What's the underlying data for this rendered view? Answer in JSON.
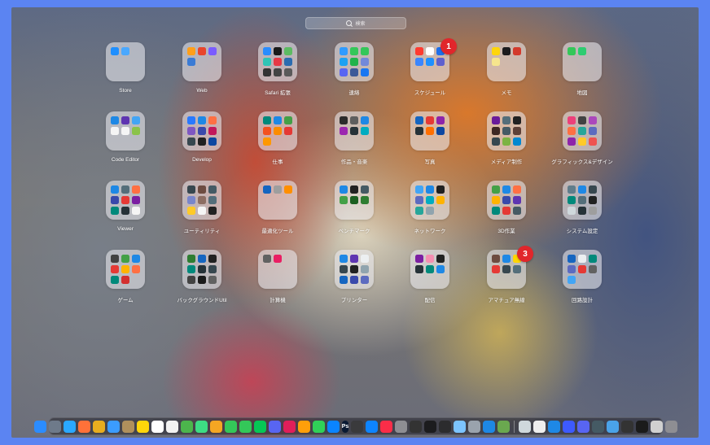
{
  "search": {
    "placeholder": "検索"
  },
  "folders": [
    {
      "label": "Store",
      "apps": [
        "#1f8fff",
        "#4aa8ff"
      ]
    },
    {
      "label": "Web",
      "apps": [
        "#ff9f1a",
        "#e8452c",
        "#7a5cff",
        "#3a7bd5"
      ]
    },
    {
      "label": "Safari 拡張",
      "apps": [
        "#2a8cff",
        "#1a1a1a",
        "#5dbb63",
        "#2ec4b6",
        "#e63946",
        "#2b6cb0",
        "#333333",
        "#444444",
        "#5a5a5a"
      ]
    },
    {
      "label": "連絡",
      "apps": [
        "#2f9bff",
        "#34c759",
        "#34c759",
        "#1da1f2",
        "#20b34a",
        "#7289da",
        "#5865f2",
        "#3b5998",
        "#1877f2"
      ]
    },
    {
      "label": "スケジュール",
      "apps": [
        "#ff3b30",
        "#ffffff",
        "#1f6feb",
        "#3a86ff",
        "#1e90ff",
        "#5e60ce"
      ],
      "badge": "1"
    },
    {
      "label": "メモ",
      "apps": [
        "#ffd60a",
        "#1c1c1e",
        "#d33a2c",
        "#f6e58d"
      ]
    },
    {
      "label": "地図",
      "apps": [
        "#34c759",
        "#2ecc71"
      ]
    },
    {
      "label": "Code Editor",
      "apps": [
        "#1e88e5",
        "#5e35b1",
        "#42a5f5",
        "#f5f5f5",
        "#f5f5f5",
        "#8bc34a"
      ]
    },
    {
      "label": "Develop",
      "apps": [
        "#2979ff",
        "#1e88e5",
        "#ff7043",
        "#7e57c2",
        "#3949ab",
        "#c2185b",
        "#37474f",
        "#212121",
        "#0d47a1"
      ]
    },
    {
      "label": "仕事",
      "apps": [
        "#00897b",
        "#1e88e5",
        "#43a047",
        "#f4511e",
        "#fb8c00",
        "#e53935",
        "#ff9800"
      ]
    },
    {
      "label": "作品・音楽",
      "apps": [
        "#2b2b2b",
        "#5e5e5e",
        "#1e88e5",
        "#9c27b0",
        "#263238",
        "#00acc1"
      ]
    },
    {
      "label": "写真",
      "apps": [
        "#1565c0",
        "#e53935",
        "#8e24aa",
        "#263238",
        "#ff6f00",
        "#0d47a1"
      ]
    },
    {
      "label": "メディア制作",
      "apps": [
        "#6a1b9a",
        "#546e7a",
        "#212121",
        "#3e2723",
        "#455a64",
        "#5d4037",
        "#37474f",
        "#7cb342",
        "#0288d1"
      ]
    },
    {
      "label": "グラフィックス&デザイン",
      "apps": [
        "#ec407a",
        "#424242",
        "#ab47bc",
        "#ff7043",
        "#26a69a",
        "#5c6bc0",
        "#8e24aa",
        "#ffca28",
        "#ef5350"
      ]
    },
    {
      "label": "Viewer",
      "apps": [
        "#1e88e5",
        "#546e7a",
        "#ff7043",
        "#3949ab",
        "#e53935",
        "#7b1fa2",
        "#00897b",
        "#263238",
        "#f5f5f5"
      ]
    },
    {
      "label": "ユーティリティ",
      "apps": [
        "#37474f",
        "#6d4c41",
        "#455a64",
        "#7986cb",
        "#8d6e63",
        "#546e7a",
        "#ffca28",
        "#f5f5f5",
        "#212121"
      ]
    },
    {
      "label": "最適化ツール",
      "apps": [
        "#1565c0",
        "#9e9e9e",
        "#ff8f00"
      ]
    },
    {
      "label": "ベンチマーク",
      "apps": [
        "#1e88e5",
        "#212121",
        "#455a64",
        "#43a047",
        "#1b5e20",
        "#2e7d32"
      ]
    },
    {
      "label": "ネットワーク",
      "apps": [
        "#42a5f5",
        "#1e88e5",
        "#212121",
        "#5c6bc0",
        "#00acc1",
        "#ffb300",
        "#26a69a",
        "#90a4ae"
      ]
    },
    {
      "label": "3D作業",
      "apps": [
        "#43a047",
        "#1e88e5",
        "#ff7043",
        "#ffb300",
        "#3949ab",
        "#5e35b1",
        "#00897b",
        "#e53935",
        "#455a64"
      ]
    },
    {
      "label": "システム設定",
      "apps": [
        "#607d8b",
        "#1e88e5",
        "#37474f",
        "#00897b",
        "#546e7a",
        "#212121",
        "#cfd8dc",
        "#263238",
        "#9e9e9e"
      ]
    },
    {
      "label": "ゲーム",
      "apps": [
        "#424242",
        "#43a047",
        "#1e88e5",
        "#e53935",
        "#ffb300",
        "#ff7043",
        "#00897b",
        "#d32f2f"
      ]
    },
    {
      "label": "バックグラウンドUtil",
      "apps": [
        "#2e7d32",
        "#1565c0",
        "#212121",
        "#00897b",
        "#263238",
        "#37474f",
        "#424242",
        "#1b1b1b",
        "#616161"
      ]
    },
    {
      "label": "計算機",
      "apps": [
        "#616161",
        "#e91e63"
      ]
    },
    {
      "label": "プリンター",
      "apps": [
        "#1e88e5",
        "#5e35b1",
        "#eceff1",
        "#37474f",
        "#212121",
        "#90a4ae",
        "#1565c0",
        "#3949ab",
        "#5c6bc0"
      ]
    },
    {
      "label": "配信",
      "apps": [
        "#7b1fa2",
        "#f48fb1",
        "#212121",
        "#263238",
        "#00897b",
        "#1e88e5"
      ]
    },
    {
      "label": "アマチュア無線",
      "apps": [
        "#6d4c41",
        "#1e88e5",
        "#ffd600",
        "#e53935",
        "#37474f",
        "#546e7a"
      ],
      "badge": "3"
    },
    {
      "label": "回路設計",
      "apps": [
        "#1565c0",
        "#eceff1",
        "#00897b",
        "#5c6bc0",
        "#e53935",
        "#616161",
        "#42a5f5"
      ]
    }
  ],
  "dock": {
    "ps_label": "Ps",
    "apps": [
      {
        "name": "finder",
        "color": "#2b8cff"
      },
      {
        "name": "launchpad",
        "color": "#6e7a8a"
      },
      {
        "name": "safari",
        "color": "#2aa8ff"
      },
      {
        "name": "firefox",
        "color": "#ff7139"
      },
      {
        "name": "chrome",
        "color": "#e8ad1f"
      },
      {
        "name": "mail",
        "color": "#3b9cff"
      },
      {
        "name": "notes-book",
        "color": "#b0905c"
      },
      {
        "name": "notes",
        "color": "#ffd60a"
      },
      {
        "name": "calendar",
        "color": "#ffffff"
      },
      {
        "name": "reminders",
        "color": "#f2f2f2"
      },
      {
        "name": "maps",
        "color": "#4cb54c"
      },
      {
        "name": "find-my",
        "color": "#3ddc84"
      },
      {
        "name": "photos",
        "color": "#f5a623"
      },
      {
        "name": "facetime",
        "color": "#34c759"
      },
      {
        "name": "messages",
        "color": "#34c759"
      },
      {
        "name": "line",
        "color": "#06c755"
      },
      {
        "name": "discord",
        "color": "#5865f2"
      },
      {
        "name": "slack",
        "color": "#e01e5a"
      },
      {
        "name": "pages",
        "color": "#ff9f0a"
      },
      {
        "name": "numbers",
        "color": "#30d158"
      },
      {
        "name": "keynote",
        "color": "#0a84ff"
      },
      {
        "name": "photoshop",
        "color": "#0a1a33"
      },
      {
        "name": "final-cut",
        "color": "#3a3a3c"
      },
      {
        "name": "app-store",
        "color": "#0d84ff"
      },
      {
        "name": "music",
        "color": "#fa2d48"
      },
      {
        "name": "settings",
        "color": "#8e8e93"
      },
      {
        "name": "activity",
        "color": "#333333"
      },
      {
        "name": "terminal",
        "color": "#1c1c1e"
      },
      {
        "name": "console",
        "color": "#2c2c2e"
      },
      {
        "name": "preview",
        "color": "#7cc4ff"
      },
      {
        "name": "disk-utility",
        "color": "#9aa3ad"
      },
      {
        "name": "xcode",
        "color": "#1e88e5"
      },
      {
        "name": "minecraft",
        "color": "#6aa84f"
      }
    ],
    "apps_right": [
      {
        "name": "notes-alt",
        "color": "#cfd8dc"
      },
      {
        "name": "script",
        "color": "#eeeeee"
      },
      {
        "name": "box",
        "color": "#1e88e5"
      },
      {
        "name": "cube",
        "color": "#3d5afe"
      },
      {
        "name": "discord-alt",
        "color": "#5865f2"
      },
      {
        "name": "screen",
        "color": "#455a64"
      },
      {
        "name": "folder",
        "color": "#4aa3e8"
      },
      {
        "name": "app-a",
        "color": "#333333"
      },
      {
        "name": "app-b",
        "color": "#1b1b1b"
      },
      {
        "name": "downloads",
        "color": "#d0d0d0"
      },
      {
        "name": "trash",
        "color": "#8e8e93"
      }
    ]
  }
}
